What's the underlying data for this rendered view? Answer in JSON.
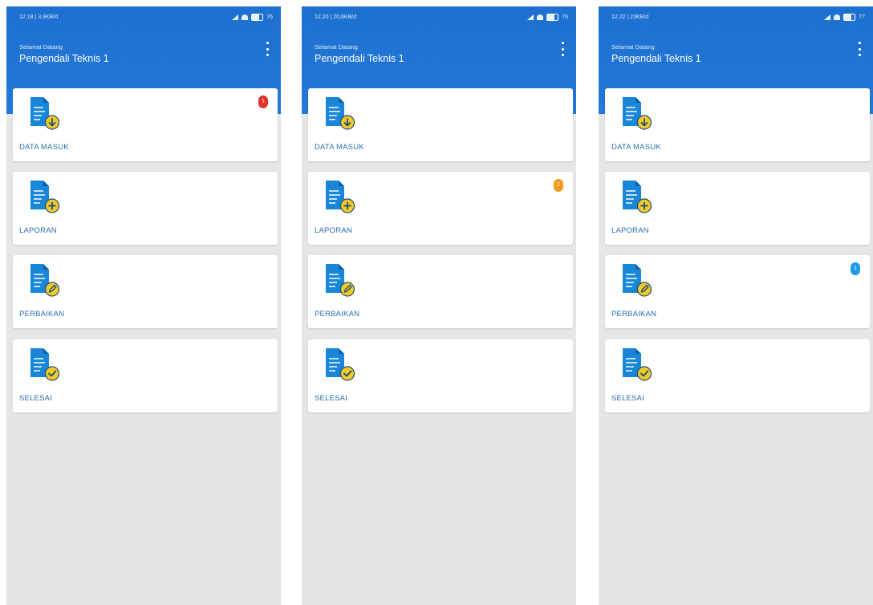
{
  "phones": [
    {
      "status": {
        "time": "12.18 | 3,9KB/d",
        "battery": "76"
      },
      "header": {
        "greeting": "Selamat Datang",
        "title": "Pengendali Teknis 1"
      },
      "badge": {
        "card_index": 0,
        "text": "1",
        "color": "#e0342f"
      }
    },
    {
      "status": {
        "time": "12.20 | 20,6KB/d",
        "battery": "76"
      },
      "header": {
        "greeting": "Selamat Datang",
        "title": "Pengendali Teknis 1"
      },
      "badge": {
        "card_index": 1,
        "text": "1",
        "color": "#f29a1a"
      }
    },
    {
      "status": {
        "time": "12.22 | 23KB/d",
        "battery": "77"
      },
      "header": {
        "greeting": "Selamat Datang",
        "title": "Pengendali Teknis 1"
      },
      "badge": {
        "card_index": 2,
        "text": "1",
        "color": "#1a9be8"
      }
    }
  ],
  "cards": [
    {
      "label": "DATA MASUK",
      "icon": "document-download-icon",
      "badge_symbol": "download"
    },
    {
      "label": "LAPORAN",
      "icon": "document-add-icon",
      "badge_symbol": "plus"
    },
    {
      "label": "PERBAIKAN",
      "icon": "document-edit-icon",
      "badge_symbol": "pencil"
    },
    {
      "label": "SELESAI",
      "icon": "document-check-icon",
      "badge_symbol": "check"
    }
  ],
  "colors": {
    "header_blue": "#1f73d2",
    "label_blue": "#2a6ea8",
    "background": "#e6e6e6",
    "icon_blue": "#1a86d8",
    "icon_yellow": "#f4c928"
  }
}
